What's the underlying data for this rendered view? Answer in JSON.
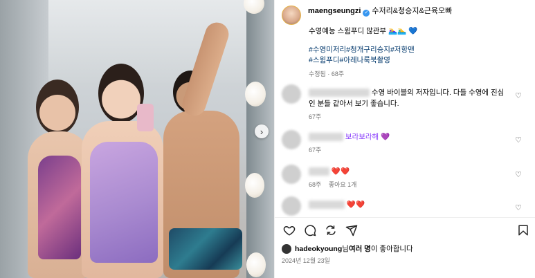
{
  "post": {
    "username": "maengseungzi",
    "coauthors": "수저리&청승지&근육오빠",
    "caption": "수영예능 스윔푸디 많관부 🏊‍♀️🏊‍♂️ 💙",
    "tags_line1": "#수영미저리#청개구리승지#저항맨",
    "tags_line2": "#스윔푸디#아레나룩북촬영",
    "meta": "수정됨 · 68주"
  },
  "comments": [
    {
      "text": "수영 바이블의 저자입니다. 다들 수영에 진심인 분들 같아서 보기 좋습니다.",
      "age": "67주"
    },
    {
      "text": "보라보라해 💜",
      "age": "67주"
    },
    {
      "text": "❤️❤️",
      "age": "68주",
      "likes": "좋아요 1개"
    },
    {
      "text": "❤️❤️",
      "age": ""
    }
  ],
  "likes": {
    "liker": "hadeokyoung",
    "suffix": "님 ",
    "others": "여러 명",
    "tail": "이 좋아합니다"
  },
  "date": "2024년 12월 23일",
  "icons": {
    "like": "heart-icon",
    "comment": "comment-icon",
    "share": "share-icon",
    "send": "send-icon",
    "save": "bookmark-icon",
    "next": "chevron-right-icon"
  }
}
